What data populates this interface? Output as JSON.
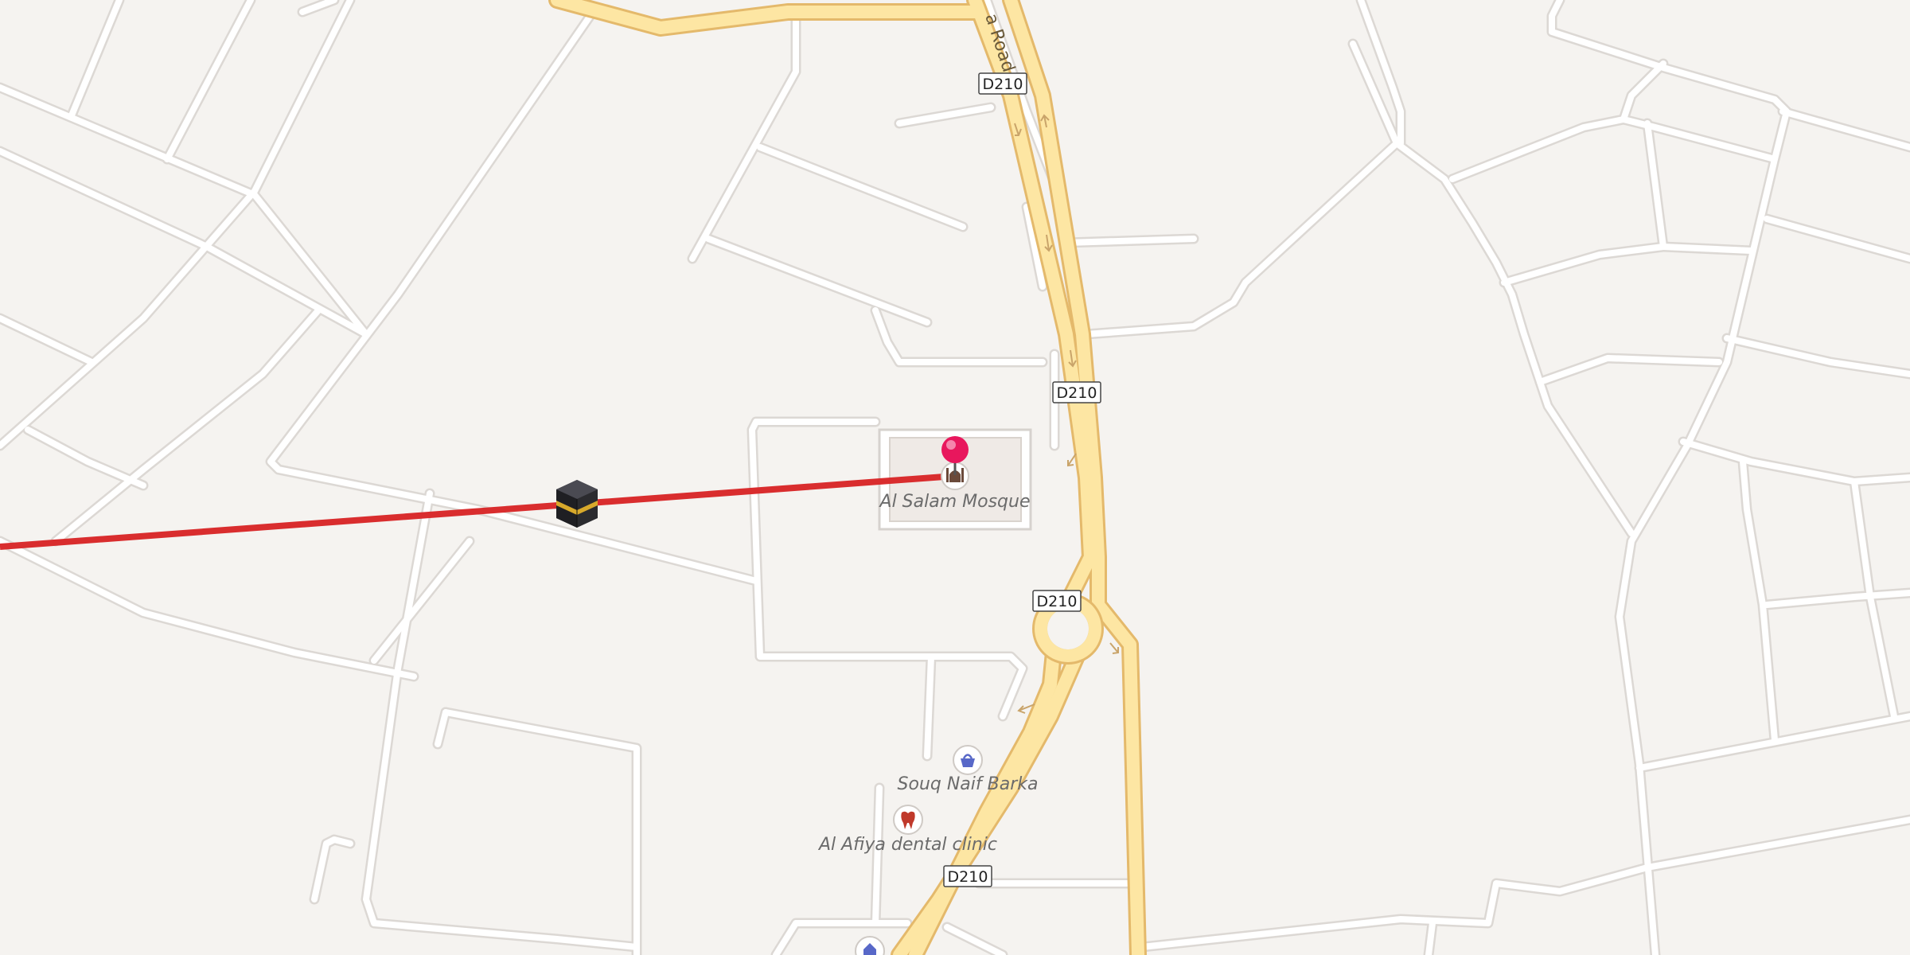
{
  "map": {
    "colors": {
      "background": "#f5f3f0",
      "minor_road": "#ffffff",
      "minor_road_casing": "#dcd8d4",
      "primary_road": "#fde6a3",
      "primary_road_casing": "#e4b96b",
      "qibla_line": "#d92d2e",
      "pin": "#e8175d"
    },
    "street_label": "a Road",
    "route_shields": [
      "D210",
      "D210",
      "D210",
      "D210"
    ],
    "pois": [
      {
        "name": "Al Salam Mosque",
        "icon": "mosque-icon"
      },
      {
        "name": "Souq Naif Barka",
        "icon": "shopping-basket-icon"
      },
      {
        "name": "Al Afiya dental clinic",
        "icon": "tooth-icon"
      }
    ],
    "markers": {
      "kaaba": {
        "icon": "kaaba-icon"
      },
      "location_pin": {
        "icon": "map-pin-icon"
      }
    }
  }
}
